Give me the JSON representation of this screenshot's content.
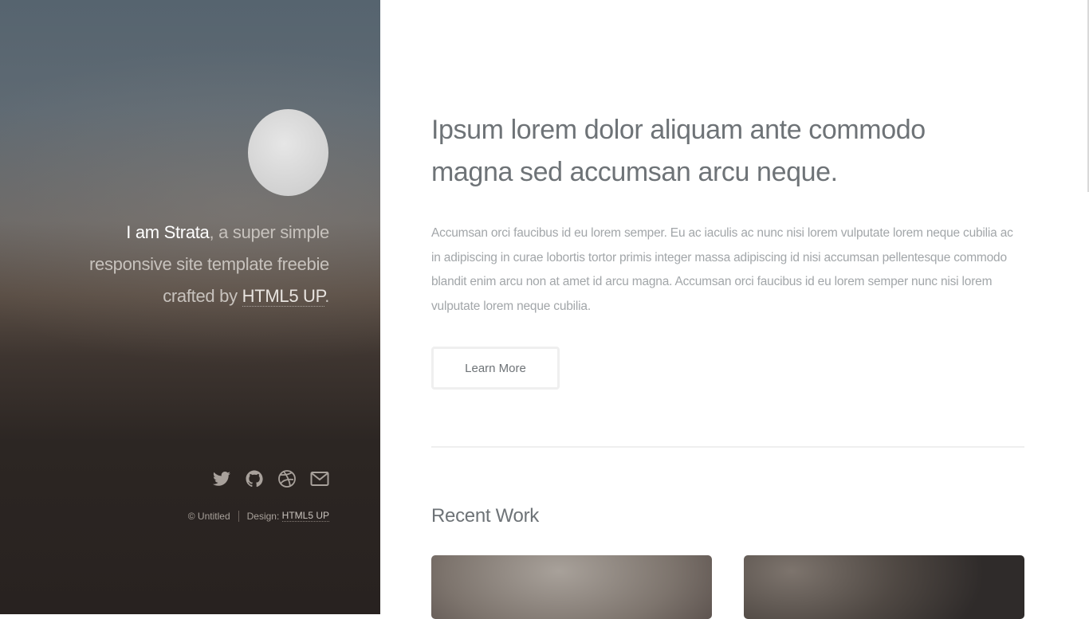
{
  "sidebar": {
    "intro": {
      "strong": "I am Strata",
      "text": ", a super simple responsive site template freebie crafted by ",
      "link": "HTML5 UP",
      "end": "."
    },
    "social_icons": [
      "twitter-icon",
      "github-icon",
      "dribbble-icon",
      "envelope-icon"
    ],
    "copyright": {
      "text": "© Untitled",
      "design_label": "Design: ",
      "design_link": "HTML5 UP"
    }
  },
  "main": {
    "headline_line1": "Ipsum lorem dolor aliquam ante commodo",
    "headline_line2": "magna sed accumsan arcu neque.",
    "body": "Accumsan orci faucibus id eu lorem semper. Eu ac iaculis ac nunc nisi lorem vulputate lorem neque cubilia ac in adipiscing in curae lobortis tortor primis integer massa adipiscing id nisi accumsan pellentesque commodo blandit enim arcu non at amet id arcu magna. Accumsan orci faucibus id eu lorem semper nunc nisi lorem vulputate lorem neque cubilia.",
    "button_label": "Learn More",
    "section_title": "Recent Work"
  },
  "colors": {
    "heading": "#6e7377",
    "body_text": "#a2a6a9",
    "sidebar_dark": "#2c2623",
    "sidebar_top": "#56646f"
  }
}
